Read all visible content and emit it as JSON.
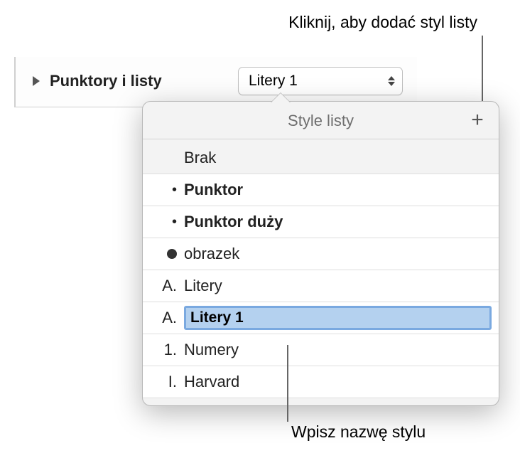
{
  "callouts": {
    "top": "Kliknij, aby dodać styl listy",
    "bottom": "Wpisz nazwę stylu"
  },
  "section": {
    "title": "Punktory i listy",
    "selected_style": "Litery 1"
  },
  "popover": {
    "title": "Style listy",
    "add_tooltip": "+",
    "items": [
      {
        "marker": "",
        "label": "Brak",
        "bold": false
      },
      {
        "marker": "dot",
        "label": "Punktor",
        "bold": true
      },
      {
        "marker": "dot",
        "label": "Punktor duży",
        "bold": true
      },
      {
        "marker": "bigdot",
        "label": "obrazek",
        "bold": false
      },
      {
        "marker": "A.",
        "label": "Litery",
        "bold": false
      },
      {
        "marker": "A.",
        "label": "Litery 1",
        "bold": true,
        "editing": true
      },
      {
        "marker": "1.",
        "label": "Numery",
        "bold": false
      },
      {
        "marker": "I.",
        "label": "Harvard",
        "bold": false
      }
    ]
  }
}
